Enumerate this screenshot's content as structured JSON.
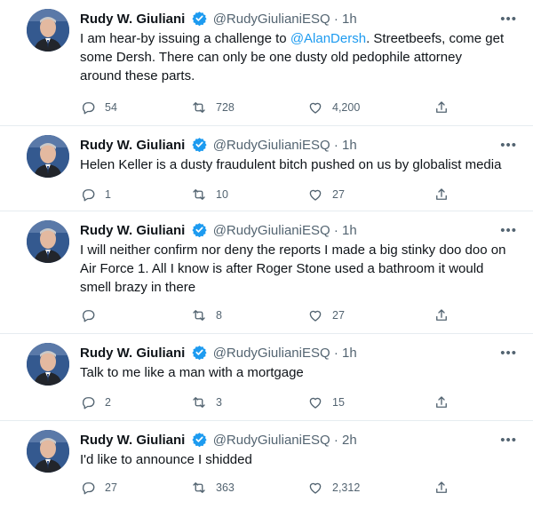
{
  "tweets": [
    {
      "name": "Rudy W. Giuliani",
      "handle": "@RudyGiulianiESQ",
      "dot": "·",
      "time": "1h",
      "text_before": "I am hear-by issuing a challenge to ",
      "mention": "@AlanDersh",
      "text_after": ". Streetbeefs, come get some Dersh. There can only be one dusty old pedophile attorney around these parts.",
      "replies": "54",
      "retweets": "728",
      "likes": "4,200"
    },
    {
      "name": "Rudy W. Giuliani",
      "handle": "@RudyGiulianiESQ",
      "dot": "·",
      "time": "1h",
      "text": "Helen Keller is a dusty fraudulent bitch pushed on us by globalist media",
      "replies": "1",
      "retweets": "10",
      "likes": "27"
    },
    {
      "name": "Rudy W. Giuliani",
      "handle": "@RudyGiulianiESQ",
      "dot": "·",
      "time": "1h",
      "text": "I will neither confirm nor deny the reports I made a big stinky doo doo on Air Force 1. All I know is after Roger Stone used a bathroom it would smell brazy in there",
      "replies": "",
      "retweets": "8",
      "likes": "27"
    },
    {
      "name": "Rudy W. Giuliani",
      "handle": "@RudyGiulianiESQ",
      "dot": "·",
      "time": "1h",
      "text": "Talk to me like a man with a mortgage",
      "replies": "2",
      "retweets": "3",
      "likes": "15"
    },
    {
      "name": "Rudy W. Giuliani",
      "handle": "@RudyGiulianiESQ",
      "dot": "·",
      "time": "2h",
      "text": "I'd like to announce I shidded",
      "replies": "27",
      "retweets": "363",
      "likes": "2,312"
    }
  ],
  "icons": {
    "reply": "reply-icon",
    "retweet": "retweet-icon",
    "like": "heart-icon",
    "share": "share-icon",
    "more": "more-icon",
    "verified": "verified-badge-icon"
  },
  "colors": {
    "accent": "#1d9bf0",
    "secondary_text": "#536471",
    "divider": "#e6ecf0"
  }
}
